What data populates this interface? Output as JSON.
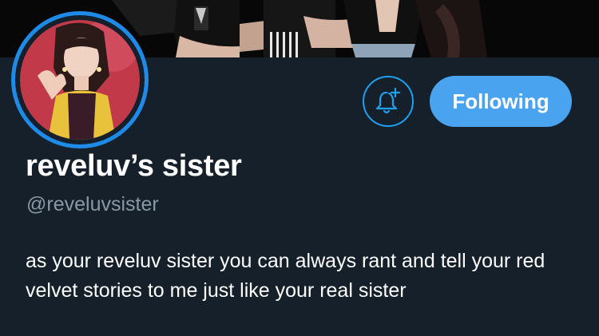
{
  "profile": {
    "display_name": "reveluv’s sister",
    "handle": "@reveluvsister",
    "bio": "as your reveluv sister you can always rant and tell your red velvet stories to me just like your real sister"
  },
  "actions": {
    "notifications_icon": "bell-plus-icon",
    "follow_label": "Following"
  },
  "colors": {
    "background": "#15202b",
    "accent": "#1da1f2",
    "following_button": "#4aa3ef",
    "avatar_ring": "#1f8be8",
    "handle_text": "#8899a6"
  }
}
